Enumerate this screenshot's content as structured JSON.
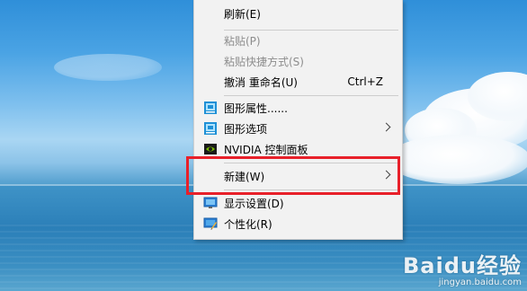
{
  "menu": {
    "items": [
      {
        "label": "刷新(E)",
        "shortcut": "",
        "enabled": true
      },
      {
        "label": "粘贴(P)",
        "shortcut": "",
        "enabled": false
      },
      {
        "label": "粘贴快捷方式(S)",
        "shortcut": "",
        "enabled": false
      },
      {
        "label": "撤消 重命名(U)",
        "shortcut": "Ctrl+Z",
        "enabled": true
      },
      {
        "label": "图形属性......",
        "icon": "intel-graphics-icon",
        "enabled": true
      },
      {
        "label": "图形选项",
        "icon": "intel-graphics-icon",
        "submenu": true,
        "enabled": true
      },
      {
        "label": "NVIDIA 控制面板",
        "icon": "nvidia-icon",
        "enabled": true
      },
      {
        "label": "新建(W)",
        "submenu": true,
        "enabled": true,
        "highlighted": true
      },
      {
        "label": "显示设置(D)",
        "icon": "display-settings-icon",
        "enabled": true
      },
      {
        "label": "个性化(R)",
        "icon": "personalize-icon",
        "enabled": true
      }
    ]
  },
  "highlight_color": "#e8202a",
  "watermark": {
    "brand": "Baidu经验",
    "url": "jingyan.baidu.com"
  }
}
